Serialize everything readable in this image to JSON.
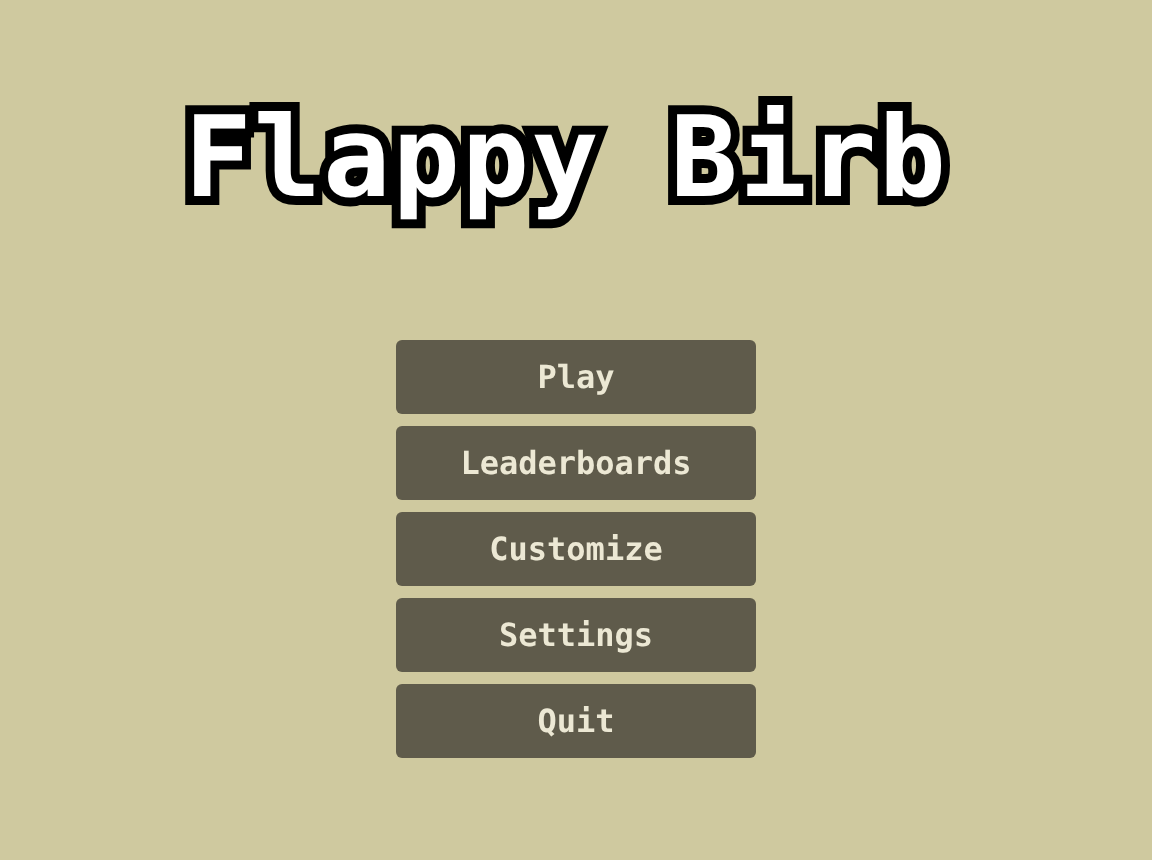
{
  "title": "Flappy Birb",
  "menu": [
    {
      "label": "Play"
    },
    {
      "label": "Leaderboards"
    },
    {
      "label": "Customize"
    },
    {
      "label": "Settings"
    },
    {
      "label": "Quit"
    }
  ]
}
